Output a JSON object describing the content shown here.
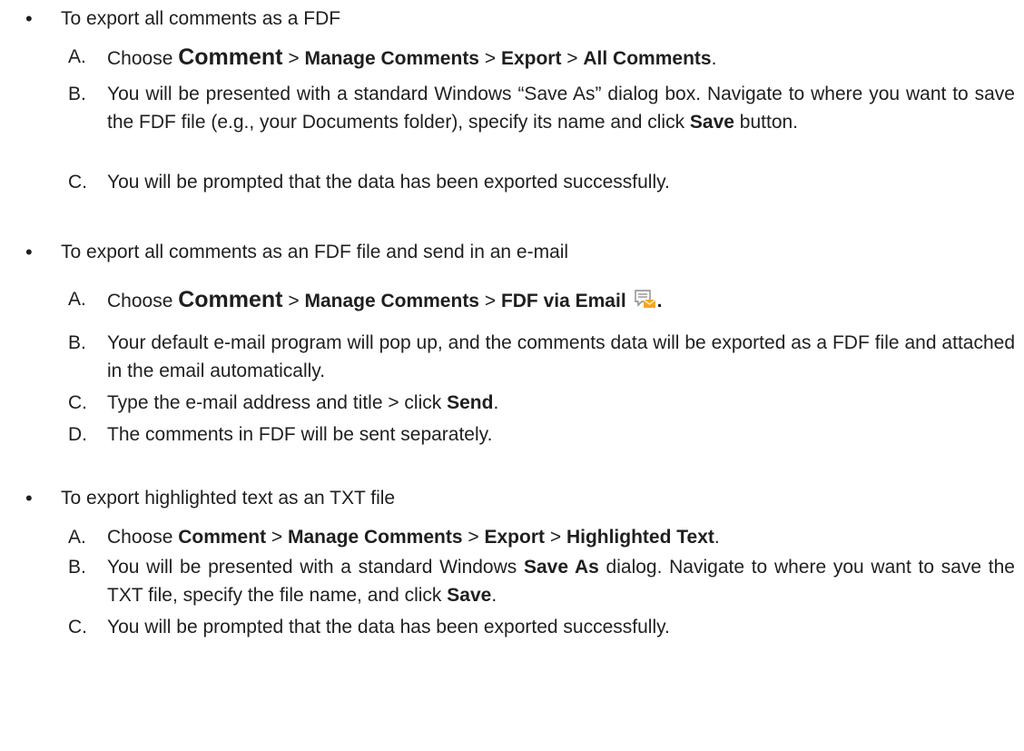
{
  "bullet_glyph": "•",
  "sections": [
    {
      "heading": "To export all comments as a FDF",
      "steps": [
        {
          "letter": "A.",
          "parts": [
            "Choose ",
            "Comment",
            " > ",
            "Manage Comments",
            " > ",
            "Export",
            " > ",
            "All Comments",
            "."
          ]
        },
        {
          "letter": "B.",
          "parts": [
            "You will be presented with a standard Windows “Save As” dialog box. Navigate to where you want to save the FDF file (e.g., your Documents folder), specify its name and click ",
            "Save",
            " button."
          ]
        },
        {
          "letter": "C.",
          "text": "You will be prompted that the data has been exported successfully."
        }
      ]
    },
    {
      "heading": "To export all comments as an FDF file and send in an e-mail",
      "steps": [
        {
          "letter": "A.",
          "parts": [
            "Choose ",
            "Comment",
            " > ",
            "Manage Comments",
            " > ",
            "FDF via Email",
            "."
          ],
          "icon": "fdf-email-icon"
        },
        {
          "letter": "B.",
          "text": "Your default e-mail program will pop up, and the comments data will be exported as a FDF file and attached in the email automatically."
        },
        {
          "letter": "C.",
          "parts": [
            "Type the e-mail address and title > click ",
            "Send",
            "."
          ]
        },
        {
          "letter": "D.",
          "text": "The comments in FDF will be sent separately."
        }
      ]
    },
    {
      "heading": "To export highlighted text as an TXT file",
      "steps": [
        {
          "letter": "A.",
          "parts": [
            "Choose ",
            "Comment",
            " > ",
            "Manage Comments",
            " > ",
            "Export",
            " > ",
            "Highlighted Text",
            "."
          ]
        },
        {
          "letter": "B.",
          "parts": [
            "You will be presented with a standard Windows ",
            "Save As",
            " dialog. Navigate to where you want to save the TXT file, specify the file name, and click ",
            "Save",
            "."
          ]
        },
        {
          "letter": "C.",
          "text": "You will be prompted that the data has been exported successfully."
        }
      ]
    }
  ],
  "colors": {
    "text": "#1f1f1f",
    "icon_orange": "#f5a623",
    "icon_gray": "#8a8a8a"
  }
}
